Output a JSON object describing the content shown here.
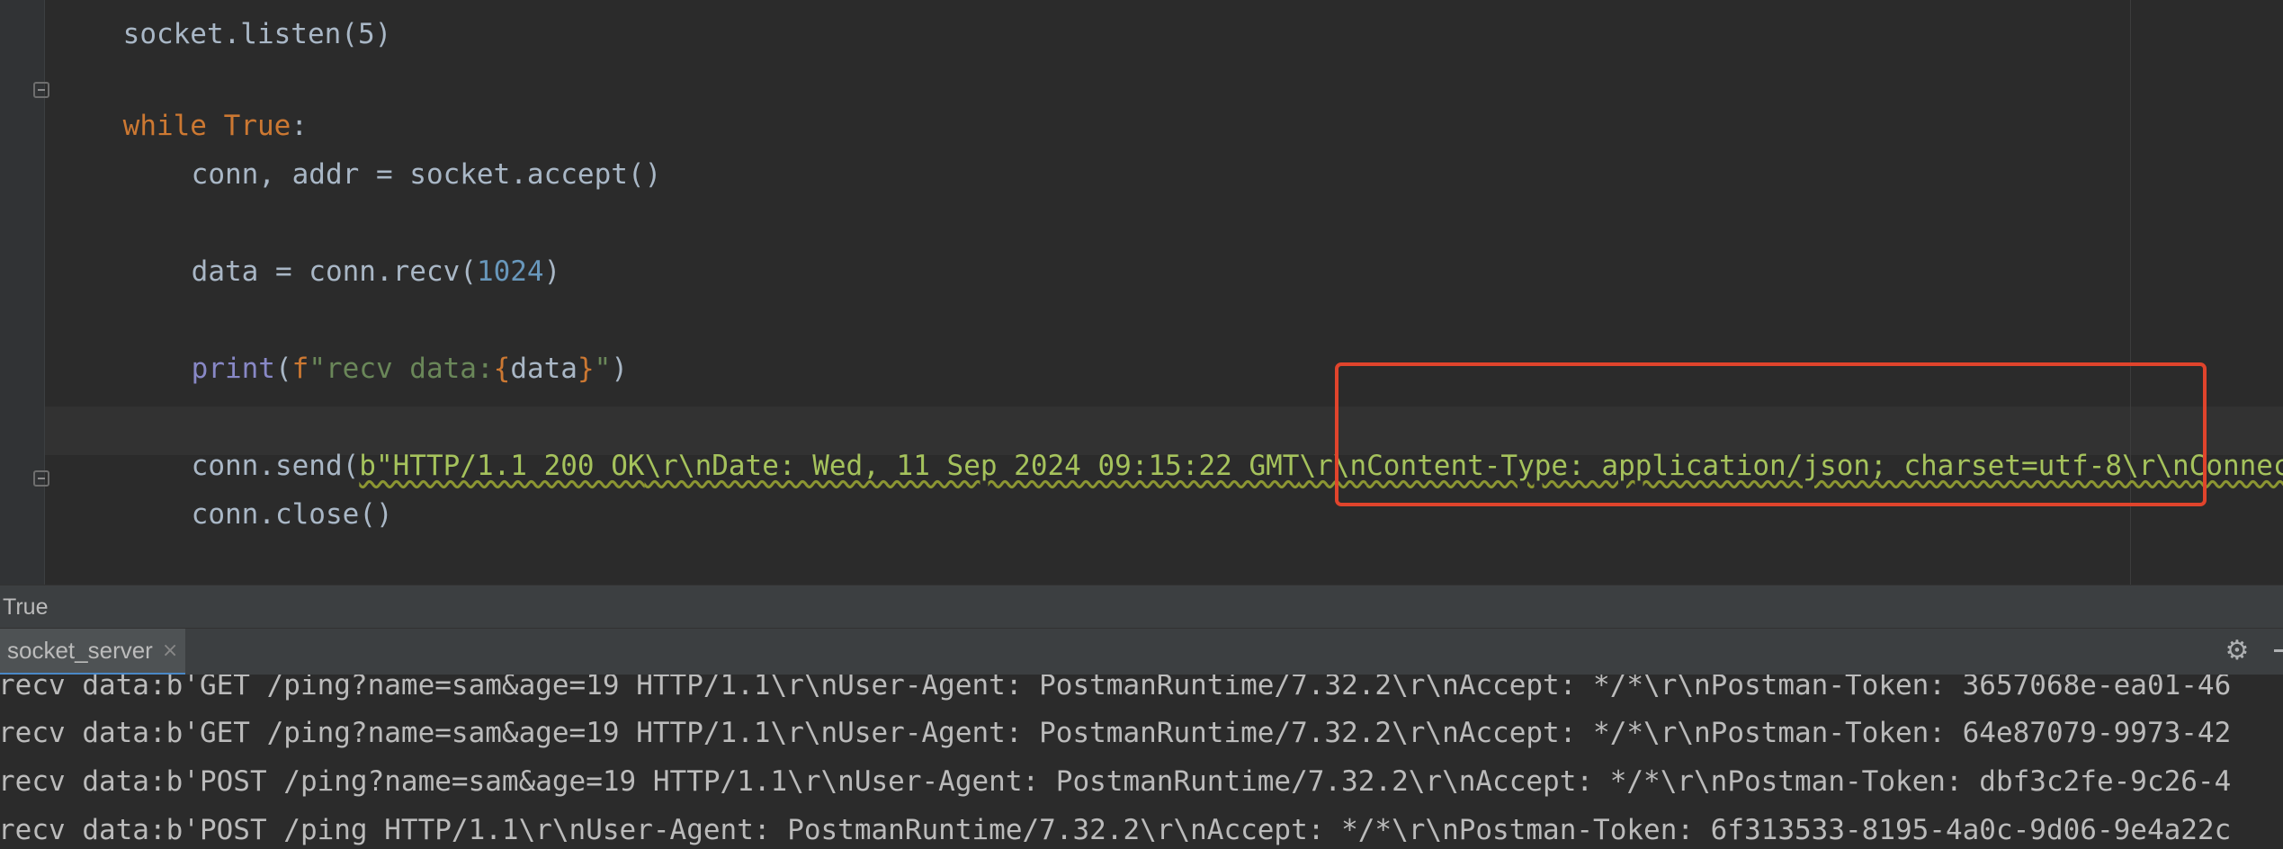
{
  "editor": {
    "top_partial": "socket.listen(5)",
    "while_kw": "while",
    "true_kw": "True",
    "colon": ":",
    "line_accept": "conn, addr = socket.accept()",
    "recv_prefix": "data = conn.recv(",
    "recv_num": "1024",
    "recv_suffix": ")",
    "print_fn": "print",
    "print_open": "(",
    "print_f": "f",
    "print_str1": "\"recv data:",
    "print_brace_open": "{",
    "print_var": "data",
    "print_brace_close": "}",
    "print_str2": "\"",
    "print_close": ")",
    "send_prefix": "conn.send(",
    "send_b1": "b\"HTTP/1.1 200 OK",
    "esc1": "\\r\\n",
    "send_b2": "Date: Wed, 11 Sep 2024 09:15:22 GMT",
    "esc2": "\\r\\n",
    "send_b3": "Content-Type: application/json; charset=utf-8",
    "esc3": "\\r\\n",
    "send_b4": "Connection: keep-alive",
    "line_close": "conn.close()"
  },
  "breadcrumb": {
    "text": "True"
  },
  "run_panel": {
    "tab_label": "socket_server",
    "close_glyph": "×",
    "settings_glyph": "⚙"
  },
  "console": {
    "lines": [
      "recv data:b'GET /ping?name=sam&age=19 HTTP/1.1\\r\\nUser-Agent: PostmanRuntime/7.32.2\\r\\nAccept: */*\\r\\nPostman-Token: 3657068e-ea01-46",
      "recv data:b'GET /ping?name=sam&age=19 HTTP/1.1\\r\\nUser-Agent: PostmanRuntime/7.32.2\\r\\nAccept: */*\\r\\nPostman-Token: 64e87079-9973-42",
      "recv data:b'POST /ping?name=sam&age=19 HTTP/1.1\\r\\nUser-Agent: PostmanRuntime/7.32.2\\r\\nAccept: */*\\r\\nPostman-Token: dbf3c2fe-9c26-4",
      "recv data:b'POST /ping HTTP/1.1\\r\\nUser-Agent: PostmanRuntime/7.32.2\\r\\nAccept: */*\\r\\nPostman-Token: 6f313533-8195-4a0c-9d06-9e4a22c"
    ]
  },
  "colors": {
    "editor_bg": "#2b2b2b",
    "keyword": "#cc7832",
    "number": "#6897bb",
    "builtin": "#8888c6",
    "string": "#6a8759",
    "bytes_string": "#a5c25c",
    "highlight_box": "#e0442c"
  }
}
